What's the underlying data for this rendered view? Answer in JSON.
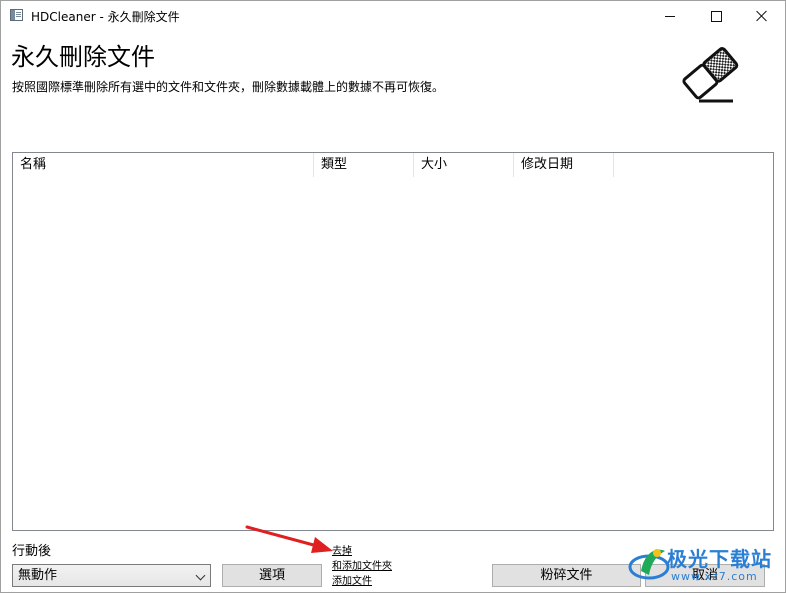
{
  "window": {
    "title": "HDCleaner - 永久刪除文件",
    "icon": "app-icon",
    "controls": [
      "minimize-icon",
      "maximize-icon",
      "close-icon"
    ]
  },
  "header": {
    "title": "永久刪除文件",
    "description": "按照國際標準刪除所有選中的文件和文件夾，刪除數據載體上的數據不再可恢復。",
    "icon": "eraser-icon"
  },
  "list": {
    "columns": [
      "名稱",
      "類型",
      "大小",
      "修改日期"
    ],
    "rows": []
  },
  "footer": {
    "after_action_label": "行動後",
    "after_action_value": "無動作",
    "options_button": "選項",
    "links": {
      "remove": "去掉",
      "add_folder": "和添加文件夾",
      "add_file": "添加文件"
    },
    "shred_button": "粉碎文件",
    "cancel_button": "取消"
  },
  "watermark": {
    "text": "极光下载站",
    "url": "www.xz7.com"
  },
  "colors": {
    "arrow": "#e02020",
    "watermark": "#2a7fd4"
  }
}
